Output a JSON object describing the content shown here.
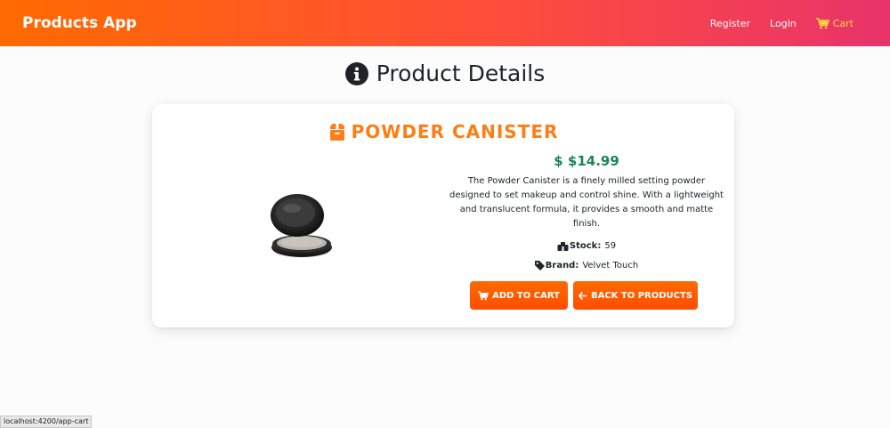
{
  "navbar": {
    "brand": "Products App",
    "links": [
      {
        "label": "Register"
      },
      {
        "label": "Login"
      },
      {
        "label": "Cart"
      }
    ]
  },
  "page": {
    "title": "Product Details"
  },
  "product": {
    "name": "POWDER CANISTER",
    "price": "$ $14.99",
    "description": "The Powder Canister is a finely milled setting powder designed to set makeup and control shine. With a lightweight and translucent formula, it provides a smooth and matte finish.",
    "stock_label": "Stock:",
    "stock_value": "59",
    "brand_label": "Brand:",
    "brand_value": "Velvet Touch"
  },
  "actions": {
    "add_to_cart": "ADD TO CART",
    "back_to_products": "BACK TO PRODUCTS"
  },
  "status_bar": {
    "url": "localhost:4200/app-cart"
  },
  "colors": {
    "accent": "#ff6a00",
    "price": "#198754",
    "cart_link": "#ffd43b"
  }
}
